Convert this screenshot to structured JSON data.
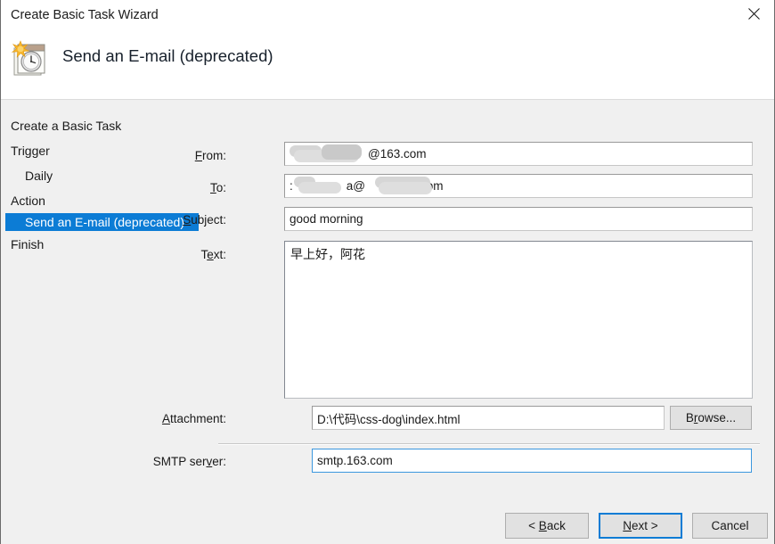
{
  "window": {
    "title": "Create Basic Task Wizard",
    "close_label": "Close",
    "close_icon": "close-icon"
  },
  "header": {
    "title": "Send an E-mail (deprecated)",
    "icon": "task-scheduler-calendar-clock-icon"
  },
  "sidebar": {
    "items": [
      {
        "label": "Create a Basic Task",
        "selected": false,
        "indent": false
      },
      {
        "label": "Trigger",
        "selected": false,
        "indent": false
      },
      {
        "label": "Daily",
        "selected": false,
        "indent": true
      },
      {
        "label": "Action",
        "selected": false,
        "indent": false
      },
      {
        "label": "Send an E-mail (deprecated)",
        "selected": true,
        "indent": true
      },
      {
        "label": "Finish",
        "selected": false,
        "indent": false
      }
    ]
  },
  "form": {
    "from": {
      "label_prefix": "",
      "label_accel": "F",
      "label_suffix": "rom:",
      "value": "@163.com",
      "redacted": true
    },
    "to": {
      "label_accel": "T",
      "label_suffix": "o:",
      "value_start": ":",
      "value_mid": "a@",
      "value_end": "com",
      "redacted": true
    },
    "subject": {
      "label_accel": "S",
      "label_suffix": "ubject:",
      "value": "good morning"
    },
    "text": {
      "label_prefix": "T",
      "label_accel": "e",
      "label_suffix": "xt:",
      "value": "早上好，阿花"
    },
    "attachment": {
      "label_accel": "A",
      "label_suffix": "ttachment:",
      "value": "D:\\代码\\css-dog\\index.html",
      "browse_prefix": "B",
      "browse_accel": "r",
      "browse_suffix": "owse..."
    },
    "smtp": {
      "label_prefix": "SMTP ser",
      "label_accel": "v",
      "label_suffix": "er:",
      "value": "smtp.163.com"
    }
  },
  "footer": {
    "back_prefix": "< ",
    "back_accel": "B",
    "back_suffix": "ack",
    "next_prefix": "",
    "next_accel": "N",
    "next_suffix": "ext >",
    "cancel_label": "Cancel"
  },
  "colors": {
    "selection_blue": "#0c7cd5",
    "focus_blue": "#3b97de",
    "dialog_bg": "#f0f0f0",
    "header_bg": "#ffffff"
  }
}
